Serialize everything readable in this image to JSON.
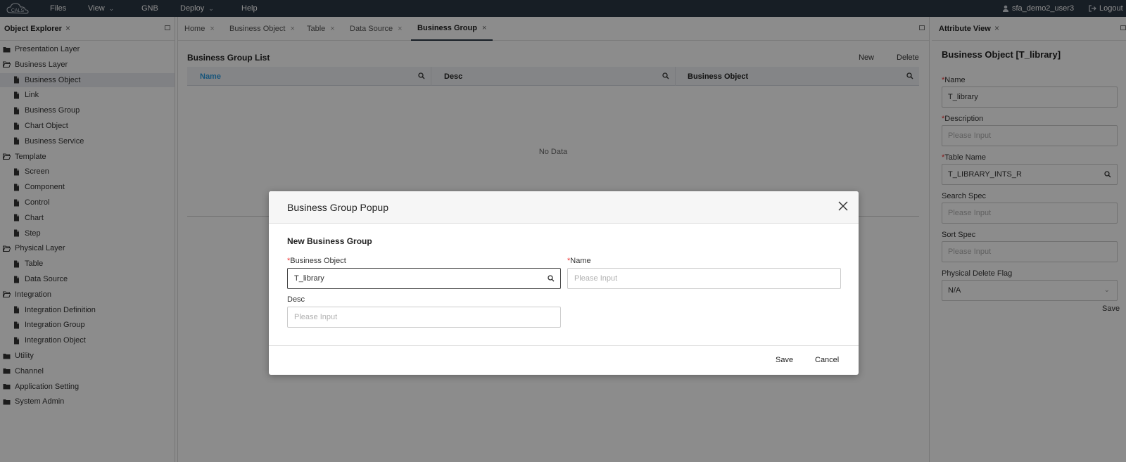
{
  "topbar": {
    "menu": [
      {
        "label": "Files",
        "has_chevron": false
      },
      {
        "label": "View",
        "has_chevron": true
      },
      {
        "label": "GNB",
        "has_chevron": false
      },
      {
        "label": "Deploy",
        "has_chevron": true
      },
      {
        "label": "Help",
        "has_chevron": false
      }
    ],
    "username": "sfa_demo2_user3",
    "logout": "Logout",
    "logo_text": "CALS"
  },
  "object_explorer": {
    "title": "Object Explorer",
    "tree": [
      {
        "label": "Presentation Layer",
        "type": "folder",
        "level": 0
      },
      {
        "label": "Business Layer",
        "type": "folder-open",
        "level": 0
      },
      {
        "label": "Business Object",
        "type": "file",
        "level": 1,
        "selected": true
      },
      {
        "label": "Link",
        "type": "file",
        "level": 1
      },
      {
        "label": "Business Group",
        "type": "file",
        "level": 1
      },
      {
        "label": "Chart Object",
        "type": "file",
        "level": 1
      },
      {
        "label": "Business Service",
        "type": "file",
        "level": 1
      },
      {
        "label": "Template",
        "type": "folder-open",
        "level": 0
      },
      {
        "label": "Screen",
        "type": "file",
        "level": 1
      },
      {
        "label": "Component",
        "type": "file",
        "level": 1
      },
      {
        "label": "Control",
        "type": "file",
        "level": 1
      },
      {
        "label": "Chart",
        "type": "file",
        "level": 1
      },
      {
        "label": "Step",
        "type": "file",
        "level": 1
      },
      {
        "label": "Physical Layer",
        "type": "folder-open",
        "level": 0
      },
      {
        "label": "Table",
        "type": "file",
        "level": 1
      },
      {
        "label": "Data Source",
        "type": "file",
        "level": 1
      },
      {
        "label": "Integration",
        "type": "folder-open",
        "level": 0
      },
      {
        "label": "Integration Definition",
        "type": "file",
        "level": 1
      },
      {
        "label": "Integration Group",
        "type": "file",
        "level": 1
      },
      {
        "label": "Integration Object",
        "type": "file",
        "level": 1
      },
      {
        "label": "Utility",
        "type": "folder",
        "level": 0
      },
      {
        "label": "Channel",
        "type": "folder",
        "level": 0
      },
      {
        "label": "Application Setting",
        "type": "folder",
        "level": 0
      },
      {
        "label": "System Admin",
        "type": "folder",
        "level": 0
      }
    ]
  },
  "tabs": [
    {
      "label": "Home",
      "active": false
    },
    {
      "label": "Business Object",
      "active": false
    },
    {
      "label": "Table",
      "active": false
    },
    {
      "label": "Data Source",
      "active": false
    },
    {
      "label": "Business Group",
      "active": true
    }
  ],
  "list": {
    "title": "Business Group List",
    "new_label": "New",
    "delete_label": "Delete",
    "columns": [
      "Name",
      "Desc",
      "Business Object"
    ],
    "empty": "No Data"
  },
  "attribute_view": {
    "title": "Attribute View",
    "object_title": "Business Object [T_library]",
    "fields": [
      {
        "label": "Name",
        "required": true,
        "value": "T_library",
        "placeholder": "",
        "kind": "text"
      },
      {
        "label": "Description",
        "required": true,
        "value": "",
        "placeholder": "Please Input",
        "kind": "text"
      },
      {
        "label": "Table Name",
        "required": true,
        "value": "T_LIBRARY_INTS_R",
        "placeholder": "",
        "kind": "search"
      },
      {
        "label": "Search Spec",
        "required": false,
        "value": "",
        "placeholder": "Please Input",
        "kind": "text"
      },
      {
        "label": "Sort Spec",
        "required": false,
        "value": "",
        "placeholder": "Please Input",
        "kind": "text"
      },
      {
        "label": "Physical Delete Flag",
        "required": false,
        "value": "N/A",
        "placeholder": "",
        "kind": "select"
      }
    ],
    "save_label": "Save"
  },
  "modal": {
    "title": "Business Group Popup",
    "subtitle": "New Business Group",
    "business_object": {
      "label": "Business Object",
      "required": true,
      "value": "T_library"
    },
    "name": {
      "label": "Name",
      "required": true,
      "placeholder": "Please Input"
    },
    "desc": {
      "label": "Desc",
      "required": false,
      "placeholder": "Please Input"
    },
    "save_label": "Save",
    "cancel_label": "Cancel"
  }
}
